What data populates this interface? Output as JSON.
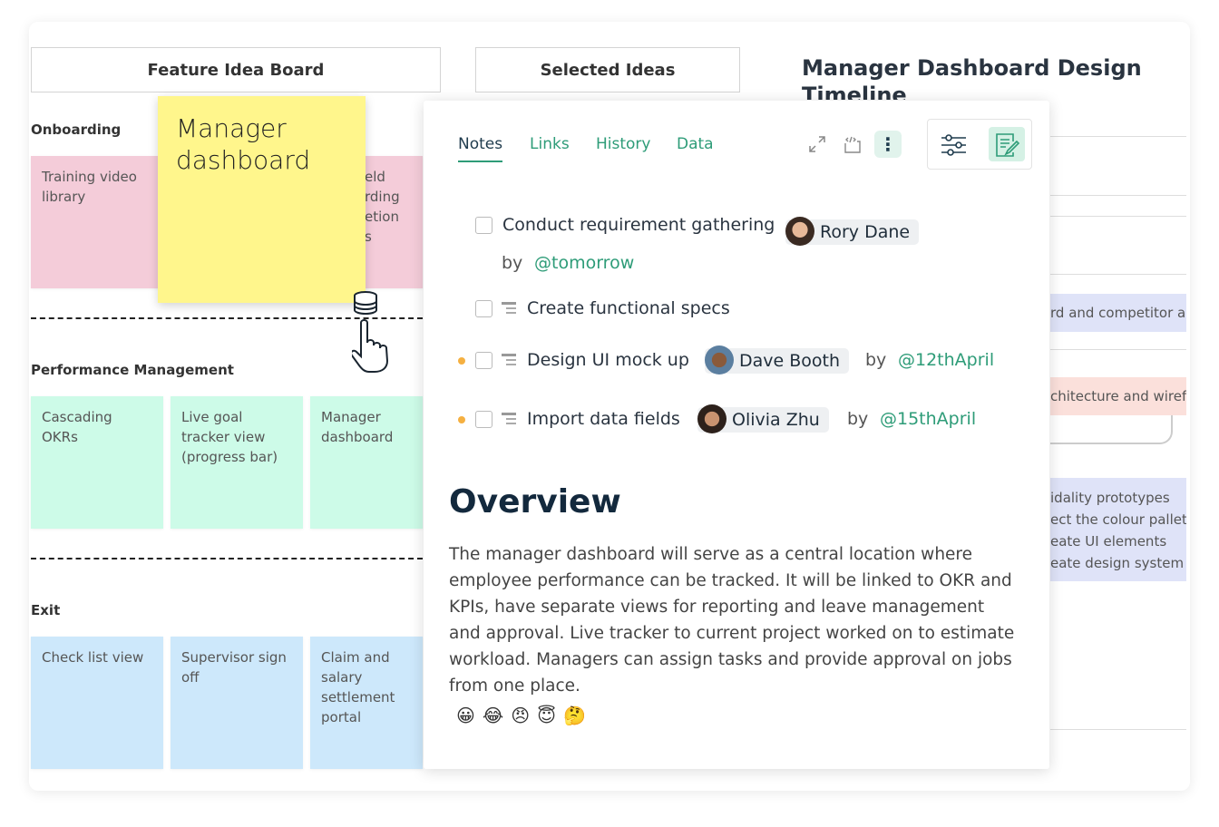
{
  "header": {
    "board_button": "Feature Idea Board",
    "selected_button": "Selected Ideas",
    "right_title": "Manager Dashboard Design Timeline"
  },
  "lanes": [
    {
      "title": "Onboarding",
      "notes": [
        "Training video library",
        "Field recording completion forms"
      ]
    },
    {
      "title": "Performance Management",
      "notes": [
        "Cascading OKRs",
        "Live goal tracker view (progress bar)",
        "Manager dashboard"
      ]
    },
    {
      "title": "Exit",
      "notes": [
        "Check list view",
        "Supervisor sign off",
        "Claim and salary settlement portal"
      ]
    }
  ],
  "onboarding_partial": [
    "eld",
    "rding",
    "etion",
    "s"
  ],
  "sticky": {
    "text": "Manager dashboard",
    "color": "#fff68c"
  },
  "timeline": {
    "bars": [
      "rd and competitor a",
      "chitecture and wiref"
    ],
    "list": [
      "idality prototypes",
      "ect the colour pallete",
      "eate UI elements",
      "eate design system"
    ]
  },
  "panel": {
    "tabs": [
      "Notes",
      "Links",
      "History",
      "Data"
    ],
    "active_tab": "Notes",
    "tasks": [
      {
        "label": "Conduct requirement gathering",
        "assignee": "Rory Dane",
        "by": "by",
        "date": "@tomorrow",
        "checked": false
      },
      {
        "label": "Create functional specs",
        "checked": false
      },
      {
        "label": "Design UI mock up",
        "assignee": "Dave Booth",
        "by": "by",
        "date": "@12thApril",
        "checked": false
      },
      {
        "label": "Import data fields",
        "assignee": "Olivia Zhu",
        "by": "by",
        "date": "@15thApril",
        "checked": false
      }
    ],
    "overview_title": "Overview",
    "overview_text": "The manager dashboard will serve as a central location where employee performance can be tracked. It will be linked to OKR and KPIs, have separate views for reporting and leave management and approval.  Live tracker to current project worked on to estimate workload. Managers can assign tasks and provide approval on jobs from one place.",
    "emojis": [
      "😀",
      "😂",
      "😠",
      "😇",
      "🤔"
    ]
  },
  "colors": {
    "accent": "#2e9c78",
    "pink": "#f4ccd9",
    "green": "#cdfbe8",
    "blue": "#cde8fb",
    "yellow": "#fff68c"
  }
}
